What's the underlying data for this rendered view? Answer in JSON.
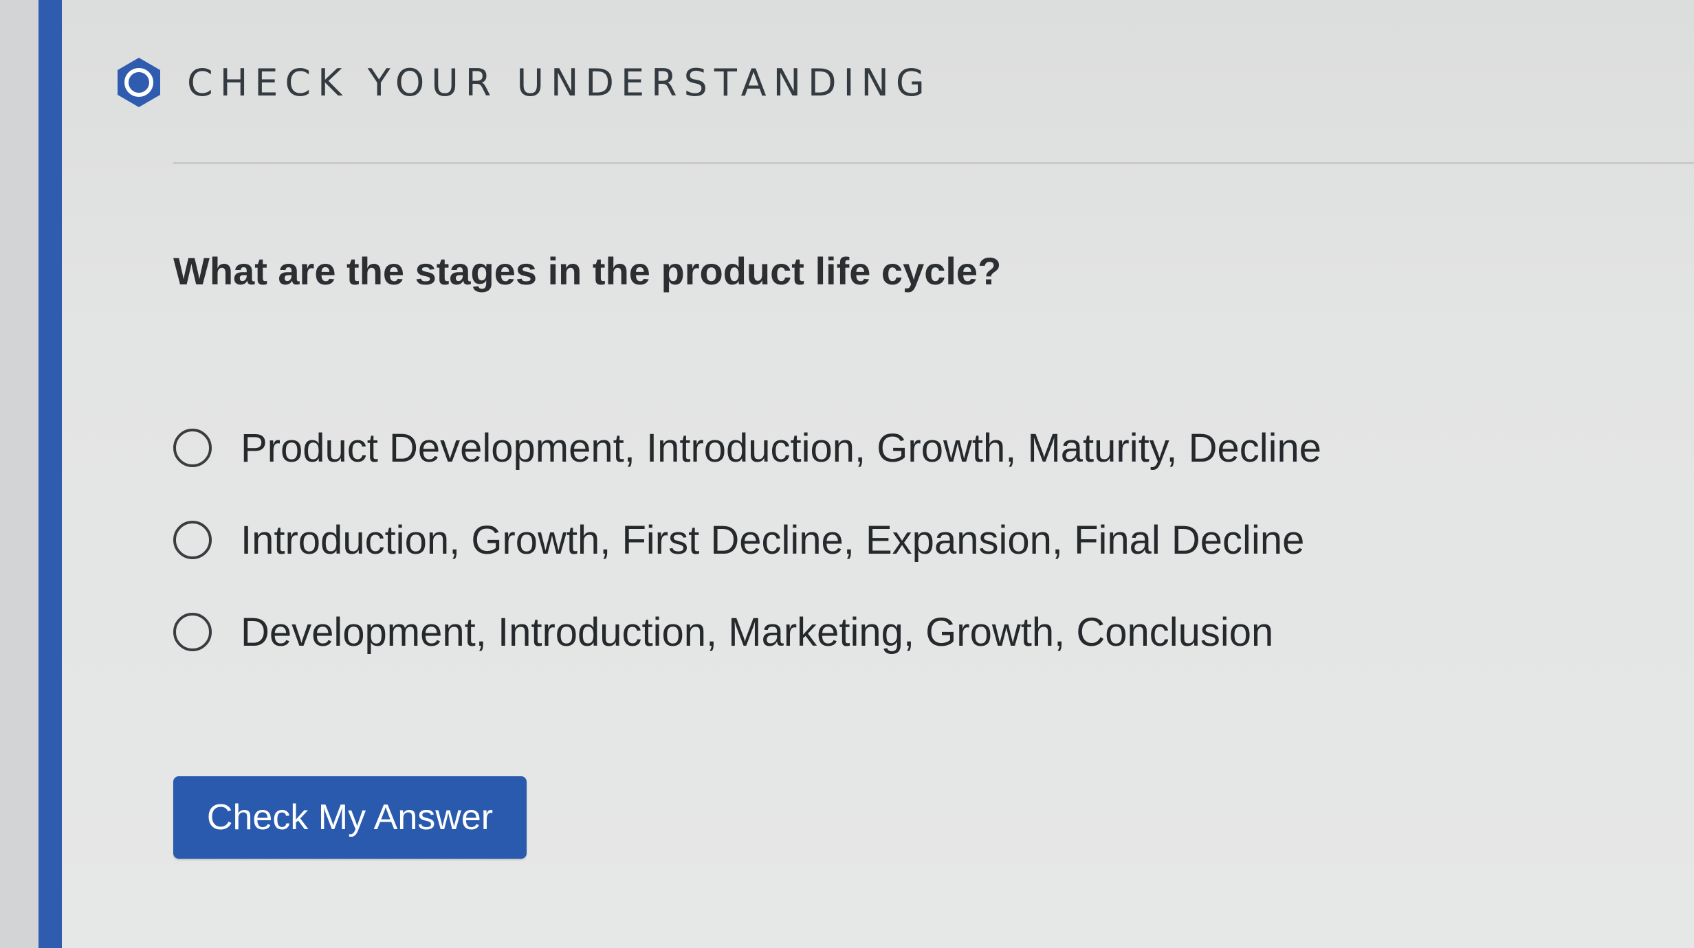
{
  "header": {
    "title": "CHECK YOUR UNDERSTANDING",
    "icon": "hexagon-ring-icon",
    "icon_color": "#2f5cae"
  },
  "question": {
    "text": "What are the stages in the product life cycle?"
  },
  "options": [
    {
      "label": "Product Development, Introduction, Growth, Maturity, Decline",
      "selected": false
    },
    {
      "label": "Introduction, Growth, First Decline, Expansion, Final Decline",
      "selected": false
    },
    {
      "label": "Development, Introduction, Marketing, Growth, Conclusion",
      "selected": false
    }
  ],
  "actions": {
    "check_label": "Check My Answer"
  },
  "colors": {
    "accent": "#2f5cae",
    "button": "#2a5aae",
    "text": "#26292c"
  }
}
